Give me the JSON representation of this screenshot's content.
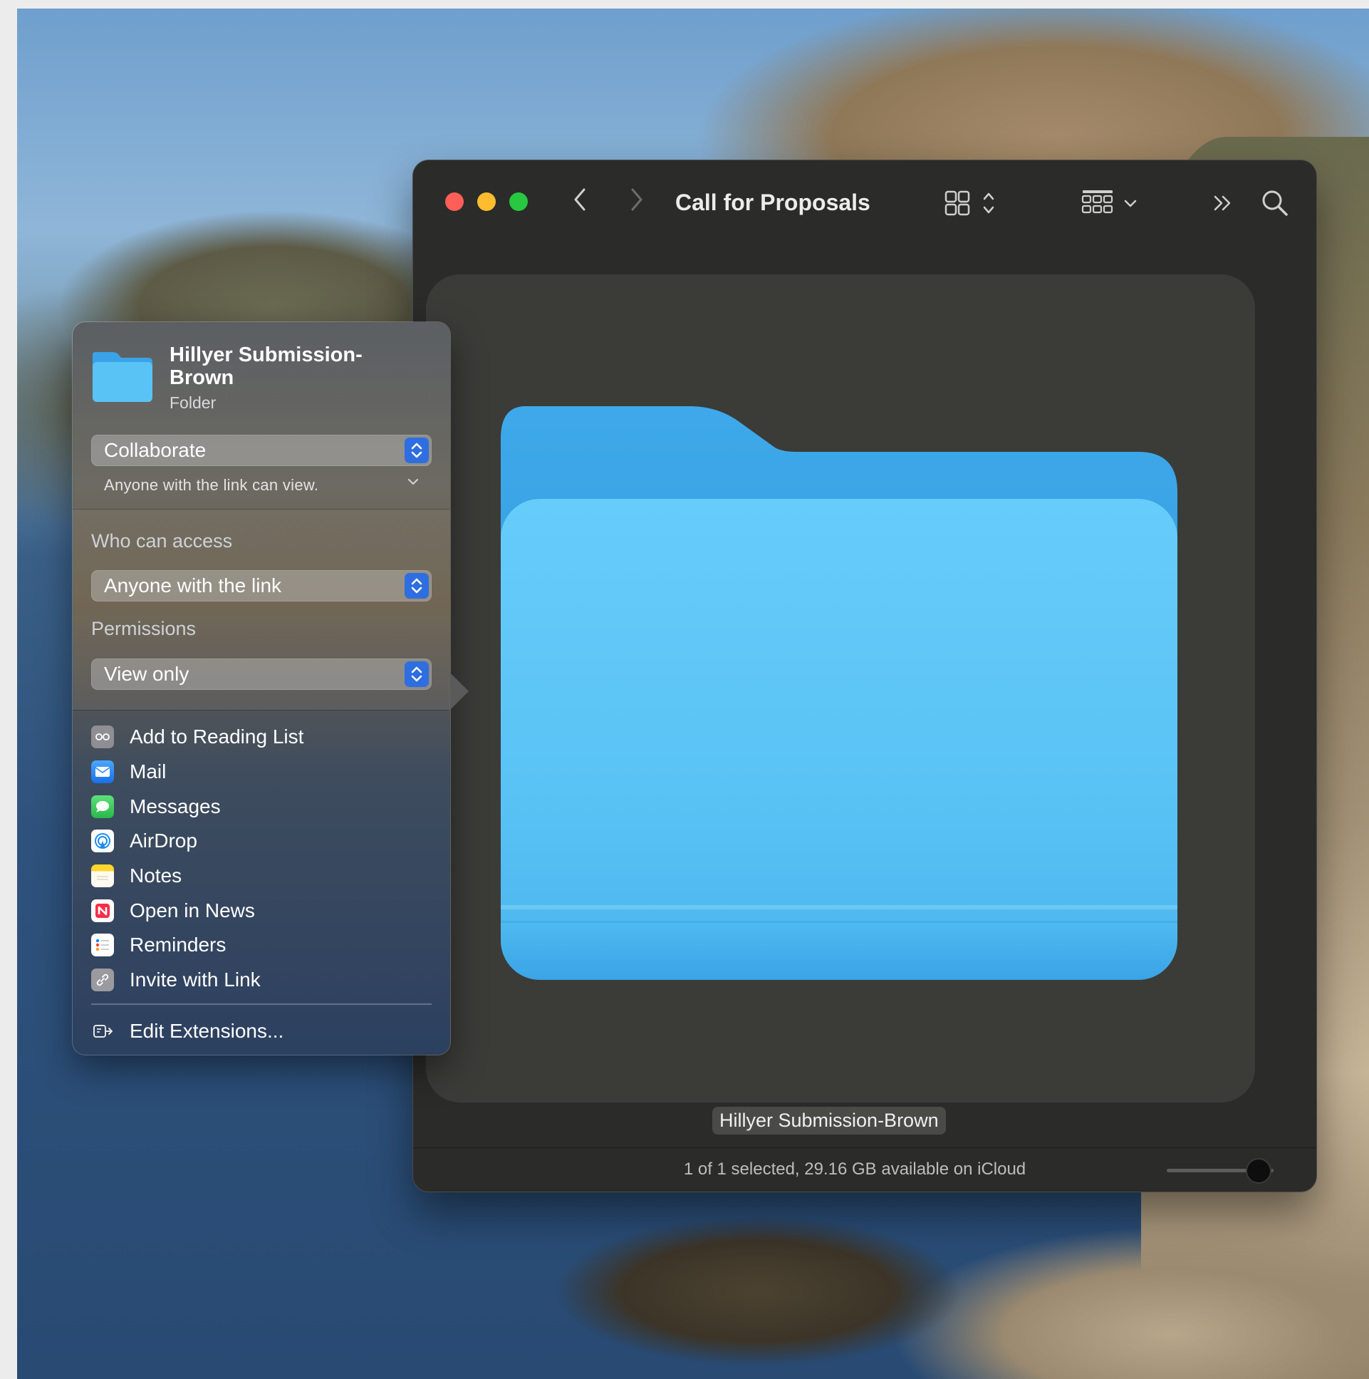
{
  "window": {
    "title": "Call for Proposals",
    "view_mode_icon": "icon-grid-icon",
    "group_icon": "group-by-icon",
    "more_icon": "chevron-double-right-icon",
    "search_icon": "search-icon"
  },
  "preview": {
    "item_name": "Hillyer Submission-Brown",
    "folder_color": "#5ac3f5"
  },
  "status_bar": {
    "text": "1 of 1 selected, 29.16 GB available on iCloud",
    "icon_size_level": 0.85
  },
  "share_popover": {
    "item_title": "Hillyer Submission-Brown",
    "item_kind": "Folder",
    "mode_select": {
      "value": "Collaborate"
    },
    "mode_description": "Anyone with the link can view.",
    "who_can_access": {
      "label": "Who can access",
      "value": "Anyone with the link"
    },
    "permissions": {
      "label": "Permissions",
      "value": "View only"
    },
    "share_options": [
      {
        "label": "Add to Reading List",
        "icon": "reading-list-icon",
        "color": "#8e8e93"
      },
      {
        "label": "Mail",
        "icon": "mail-icon",
        "color": "#2f88f5"
      },
      {
        "label": "Messages",
        "icon": "messages-icon",
        "color": "#34c759"
      },
      {
        "label": "AirDrop",
        "icon": "airdrop-icon",
        "color": "#1e8cf0"
      },
      {
        "label": "Notes",
        "icon": "notes-icon",
        "color": "#ffd52e"
      },
      {
        "label": "Open in News",
        "icon": "news-icon",
        "color": "#fa2d48"
      },
      {
        "label": "Reminders",
        "icon": "reminders-icon",
        "color": "#ffffff"
      },
      {
        "label": "Invite with Link",
        "icon": "link-icon",
        "color": "#8e8e93"
      }
    ],
    "edit_extensions": "Edit Extensions..."
  },
  "accent_color": "#2f6ee0"
}
